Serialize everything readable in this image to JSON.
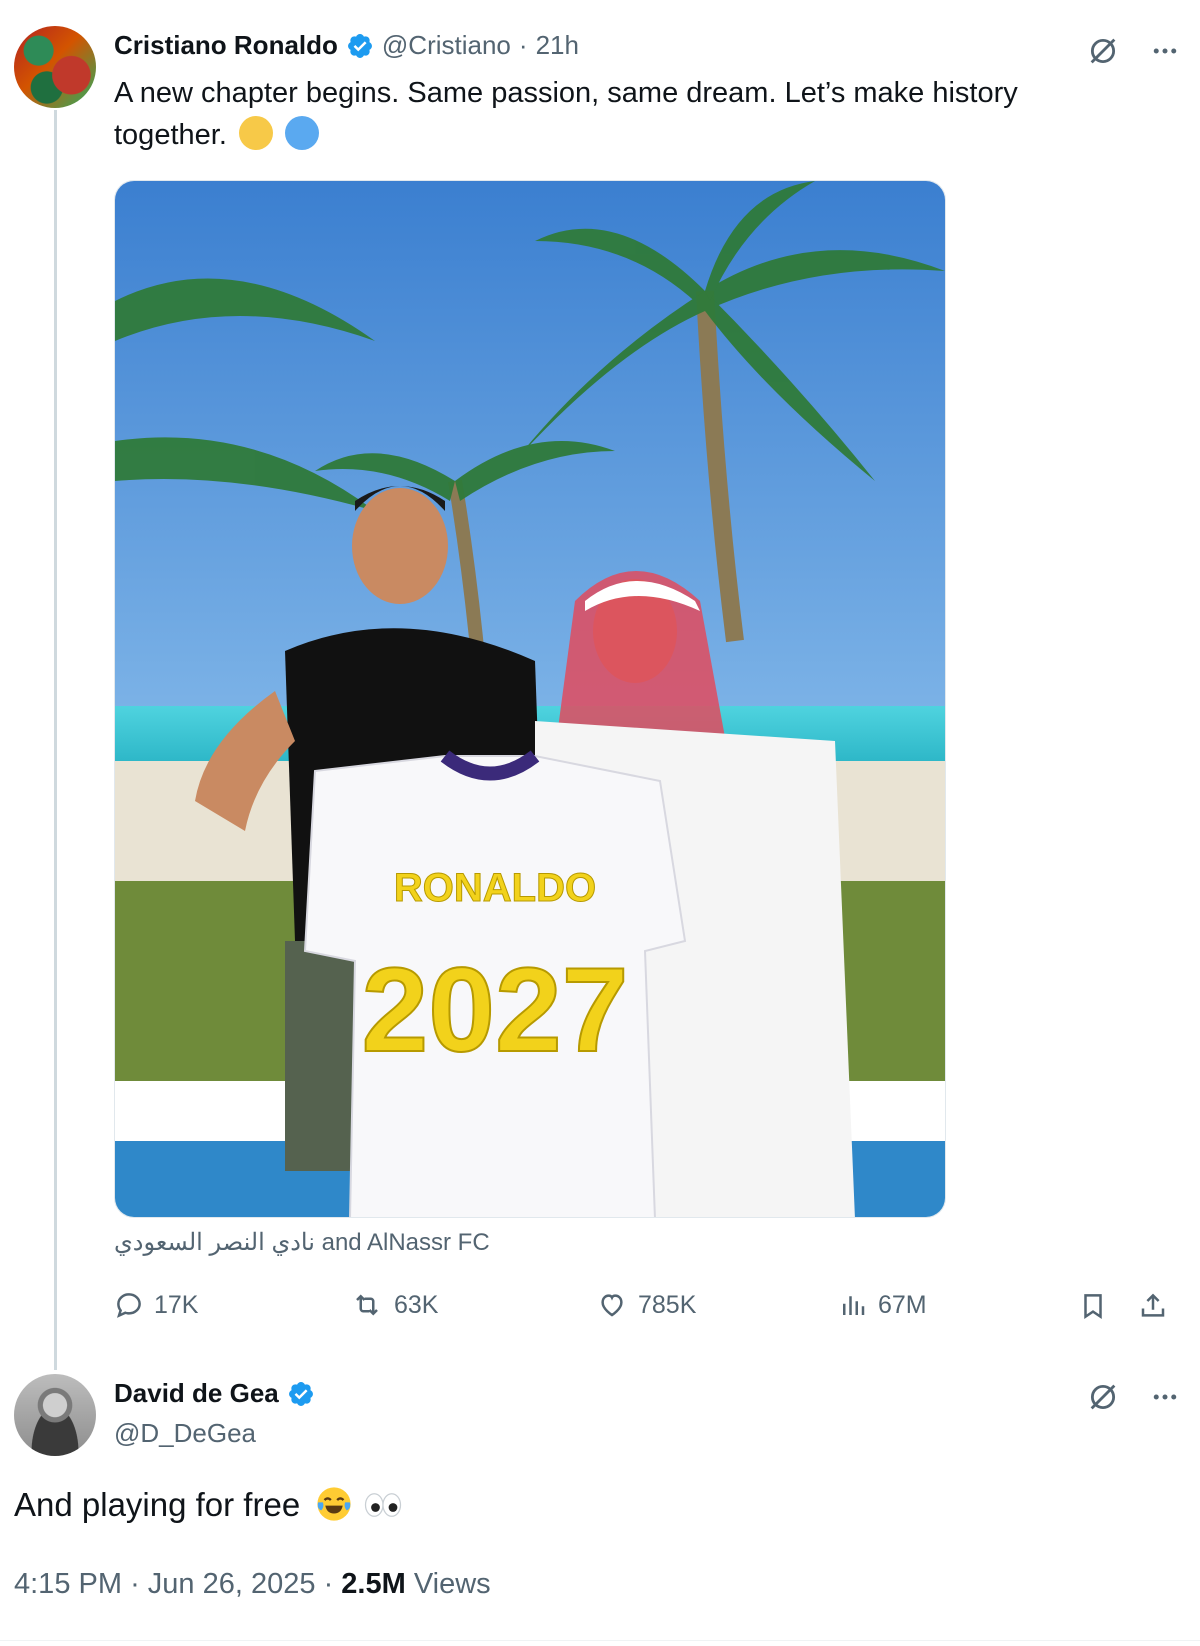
{
  "main_tweet": {
    "author_name": "Cristiano Ronaldo",
    "handle": "@Cristiano",
    "separator": "·",
    "time": "21h",
    "text": "A new chapter begins. Same passion, same dream. Let’s make history together.",
    "emojis": [
      "yellow-circle",
      "blue-circle"
    ],
    "image_alt_shirt_name": "RONALDO",
    "image_alt_shirt_number": "2027",
    "tagged_text": "نادي النصر السعودي and AlNassr FC",
    "stats": {
      "replies": "17K",
      "reposts": "63K",
      "likes": "785K",
      "views": "67M"
    }
  },
  "reply_tweet": {
    "author_name": "David de Gea",
    "handle": "@D_DeGea",
    "text": "And playing for free",
    "emojis": [
      "face-with-tears-of-joy",
      "eyes"
    ],
    "time": "4:15 PM",
    "date": "Jun 26, 2025",
    "separator": "·",
    "views_count": "2.5M",
    "views_label": "Views"
  },
  "colors": {
    "verified_blue": "#1d9bf0",
    "secondary_text": "#536471",
    "primary_text": "#0f1419",
    "emoji_yellow": "#f7c948",
    "emoji_blue": "#5aa9f0"
  }
}
